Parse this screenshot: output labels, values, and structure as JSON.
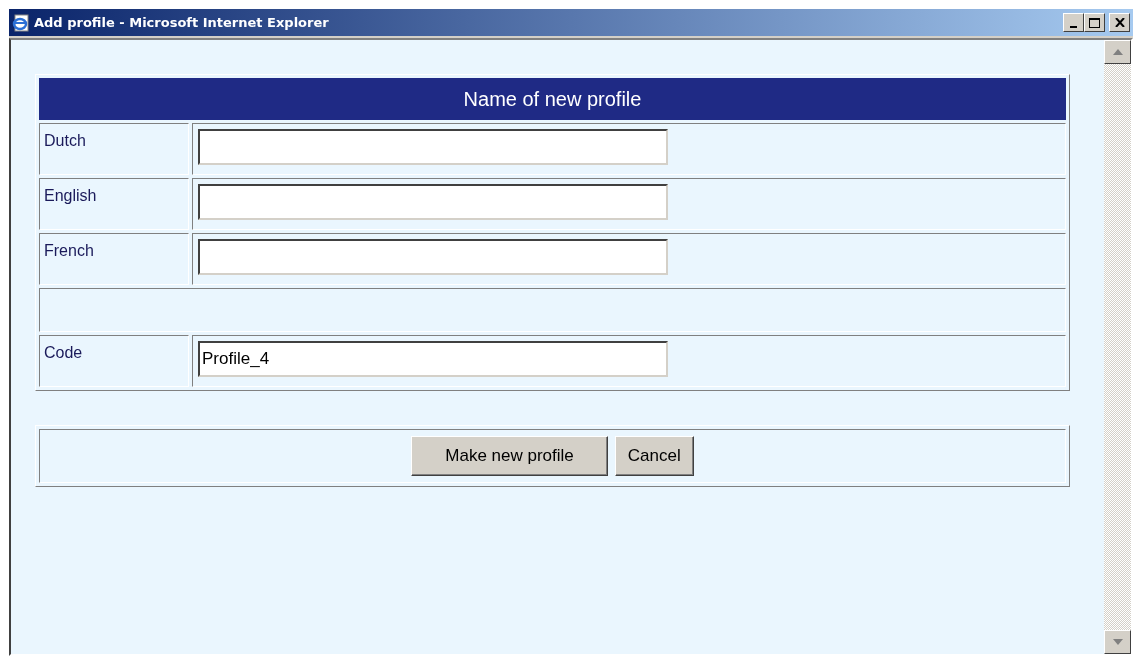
{
  "window": {
    "title": "Add profile - Microsoft Internet Explorer"
  },
  "form": {
    "heading": "Name of new profile",
    "fields": [
      {
        "label": "Dutch"
      },
      {
        "label": "English"
      },
      {
        "label": "French"
      },
      {
        "kind": "spacer"
      },
      {
        "label": "Code",
        "value": "Profile_4"
      }
    ]
  },
  "buttons": [
    "Make new profile",
    "Cancel"
  ]
}
